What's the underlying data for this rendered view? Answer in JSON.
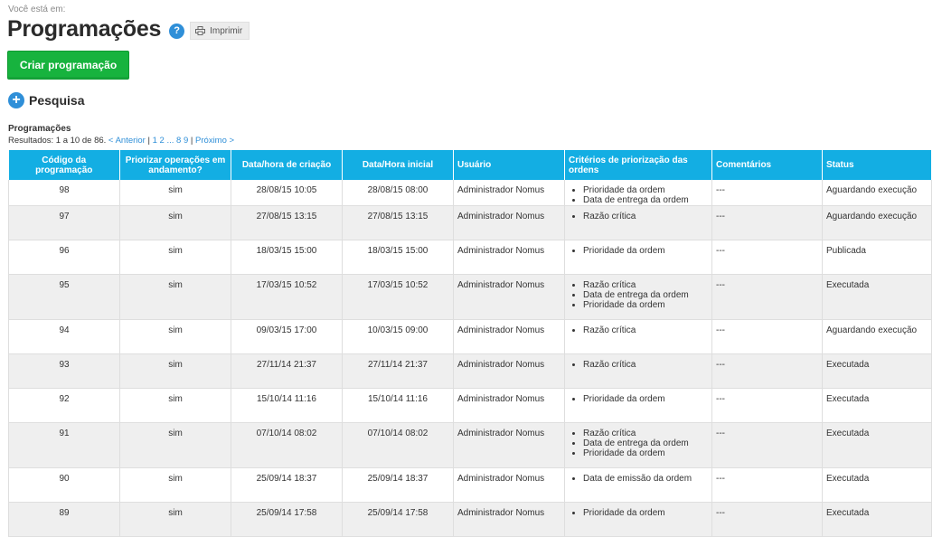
{
  "breadcrumb": "Você está em:",
  "title": "Programações",
  "help_icon": "question-circle-icon",
  "print_label": "Imprimir",
  "create_label": "Criar programação",
  "search_label": "Pesquisa",
  "section_label": "Programações",
  "pager": {
    "results": "Resultados: 1 a 10 de 86.",
    "prev": "< Anterior",
    "sep": " | ",
    "p1": "1",
    "p2": "2",
    "ellipsis": "...",
    "p8": "8",
    "p9": "9",
    "next": "Próximo >"
  },
  "columns": [
    "Código da programação",
    "Priorizar operações em andamento?",
    "Data/hora de criação",
    "Data/Hora inicial",
    "Usuário",
    "Critérios de priorização das ordens",
    "Comentários",
    "Status"
  ],
  "rows": [
    {
      "code": "98",
      "prioritize": "sim",
      "created": "28/08/15 10:05",
      "start": "28/08/15 08:00",
      "user": "Administrador Nomus",
      "criteria": [
        "Prioridade da ordem",
        "Data de entrega da ordem"
      ],
      "comments": "---",
      "status": "Aguardando execução"
    },
    {
      "code": "97",
      "prioritize": "sim",
      "created": "27/08/15 13:15",
      "start": "27/08/15 13:15",
      "user": "Administrador Nomus",
      "criteria": [
        "Razão crítica"
      ],
      "comments": "---",
      "status": "Aguardando execução"
    },
    {
      "code": "96",
      "prioritize": "sim",
      "created": "18/03/15 15:00",
      "start": "18/03/15 15:00",
      "user": "Administrador Nomus",
      "criteria": [
        "Prioridade da ordem"
      ],
      "comments": "---",
      "status": "Publicada"
    },
    {
      "code": "95",
      "prioritize": "sim",
      "created": "17/03/15 10:52",
      "start": "17/03/15 10:52",
      "user": "Administrador Nomus",
      "criteria": [
        "Razão crítica",
        "Data de entrega da ordem",
        "Prioridade da ordem"
      ],
      "comments": "---",
      "status": "Executada"
    },
    {
      "code": "94",
      "prioritize": "sim",
      "created": "09/03/15 17:00",
      "start": "10/03/15 09:00",
      "user": "Administrador Nomus",
      "criteria": [
        "Razão crítica"
      ],
      "comments": "---",
      "status": "Aguardando execução"
    },
    {
      "code": "93",
      "prioritize": "sim",
      "created": "27/11/14 21:37",
      "start": "27/11/14 21:37",
      "user": "Administrador Nomus",
      "criteria": [
        "Razão crítica"
      ],
      "comments": "---",
      "status": "Executada"
    },
    {
      "code": "92",
      "prioritize": "sim",
      "created": "15/10/14 11:16",
      "start": "15/10/14 11:16",
      "user": "Administrador Nomus",
      "criteria": [
        "Prioridade da ordem"
      ],
      "comments": "---",
      "status": "Executada"
    },
    {
      "code": "91",
      "prioritize": "sim",
      "created": "07/10/14 08:02",
      "start": "07/10/14 08:02",
      "user": "Administrador Nomus",
      "criteria": [
        "Razão crítica",
        "Data de entrega da ordem",
        "Prioridade da ordem"
      ],
      "comments": "---",
      "status": "Executada"
    },
    {
      "code": "90",
      "prioritize": "sim",
      "created": "25/09/14 18:37",
      "start": "25/09/14 18:37",
      "user": "Administrador Nomus",
      "criteria": [
        "Data de emissão da ordem"
      ],
      "comments": "---",
      "status": "Executada"
    },
    {
      "code": "89",
      "prioritize": "sim",
      "created": "25/09/14 17:58",
      "start": "25/09/14 17:58",
      "user": "Administrador Nomus",
      "criteria": [
        "Prioridade da ordem"
      ],
      "comments": "---",
      "status": "Executada"
    }
  ],
  "colors": {
    "header_bg": "#13aee3",
    "create_button": "#17b33e",
    "help_icon": "#2f8fd8",
    "link": "#2f8fd8",
    "row_alt": "#efefef"
  }
}
